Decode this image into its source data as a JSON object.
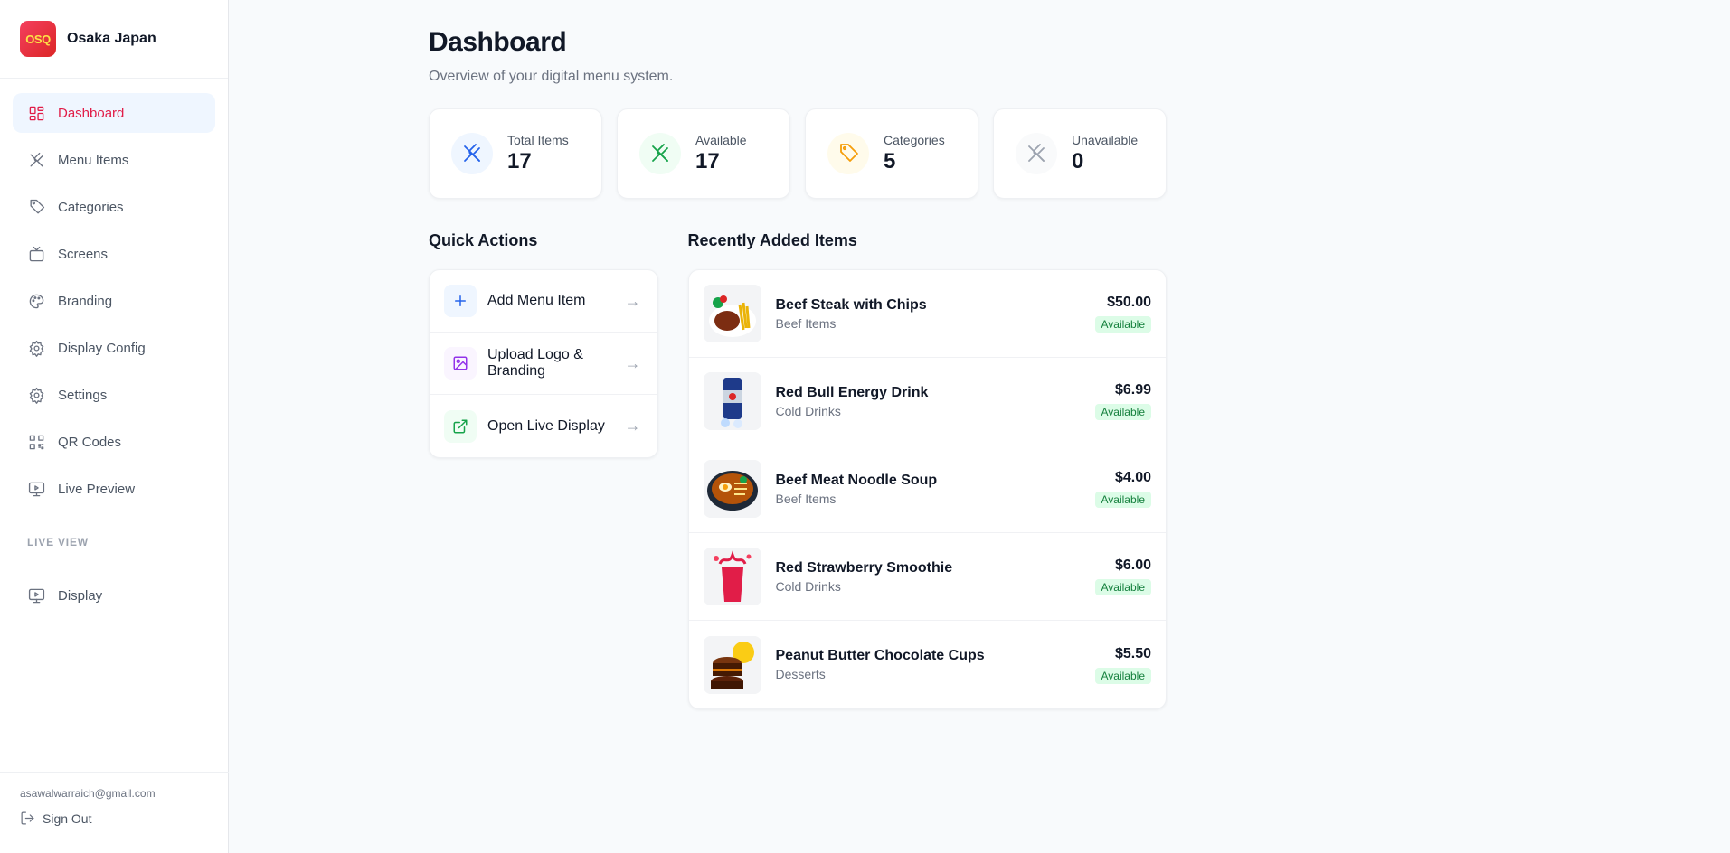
{
  "brand": {
    "name": "Osaka Japan",
    "logo_text": "OSQ"
  },
  "nav": {
    "items": [
      {
        "label": "Dashboard",
        "icon": "dashboard-icon",
        "active": true
      },
      {
        "label": "Menu Items",
        "icon": "utensils-icon"
      },
      {
        "label": "Categories",
        "icon": "tag-icon"
      },
      {
        "label": "Screens",
        "icon": "tv-icon"
      },
      {
        "label": "Branding",
        "icon": "palette-icon"
      },
      {
        "label": "Display Config",
        "icon": "gear-icon"
      },
      {
        "label": "Settings",
        "icon": "gear-icon"
      },
      {
        "label": "QR Codes",
        "icon": "qr-code-icon"
      },
      {
        "label": "Live Preview",
        "icon": "monitor-play-icon"
      }
    ],
    "live_section": "LIVE VIEW",
    "live_items": [
      {
        "label": "Display",
        "icon": "monitor-play-icon"
      }
    ]
  },
  "footer": {
    "email": "asawalwarraich@gmail.com",
    "sign_out": "Sign Out"
  },
  "header": {
    "title": "Dashboard",
    "subtitle": "Overview of your digital menu system."
  },
  "stats": [
    {
      "label": "Total Items",
      "value": "17",
      "color": "#2563eb",
      "bg": "#eff6ff"
    },
    {
      "label": "Available",
      "value": "17",
      "color": "#16a34a",
      "bg": "#f0fdf4"
    },
    {
      "label": "Categories",
      "value": "5",
      "color": "#f59e0b",
      "bg": "#fffbeb"
    },
    {
      "label": "Unavailable",
      "value": "0",
      "color": "#9ca3af",
      "bg": "#f9fafb"
    }
  ],
  "quick_actions": {
    "title": "Quick Actions",
    "items": [
      {
        "label": "Add Menu Item",
        "icon": "plus-icon",
        "arrow": "→",
        "color": "#2563eb",
        "bg": "#eff6ff"
      },
      {
        "label": "Upload Logo & Branding",
        "icon": "image-icon",
        "arrow": "→",
        "color": "#9333ea",
        "bg": "#faf5ff"
      },
      {
        "label": "Open Live Display",
        "icon": "external-link-icon",
        "arrow": "→",
        "color": "#16a34a",
        "bg": "#f0fdf4"
      }
    ]
  },
  "recent": {
    "title": "Recently Added Items",
    "items": [
      {
        "name": "Beef Steak with Chips",
        "category": "Beef Items",
        "price": "$50.00",
        "status": "Available",
        "thumb": "steak"
      },
      {
        "name": "Red Bull Energy Drink",
        "category": "Cold Drinks",
        "price": "$6.99",
        "status": "Available",
        "thumb": "can"
      },
      {
        "name": "Beef Meat Noodle Soup",
        "category": "Beef Items",
        "price": "$4.00",
        "status": "Available",
        "thumb": "bowl"
      },
      {
        "name": "Red Strawberry Smoothie",
        "category": "Cold Drinks",
        "price": "$6.00",
        "status": "Available",
        "thumb": "smoothie"
      },
      {
        "name": "Peanut Butter Chocolate Cups",
        "category": "Desserts",
        "price": "$5.50",
        "status": "Available",
        "thumb": "cups"
      }
    ]
  }
}
